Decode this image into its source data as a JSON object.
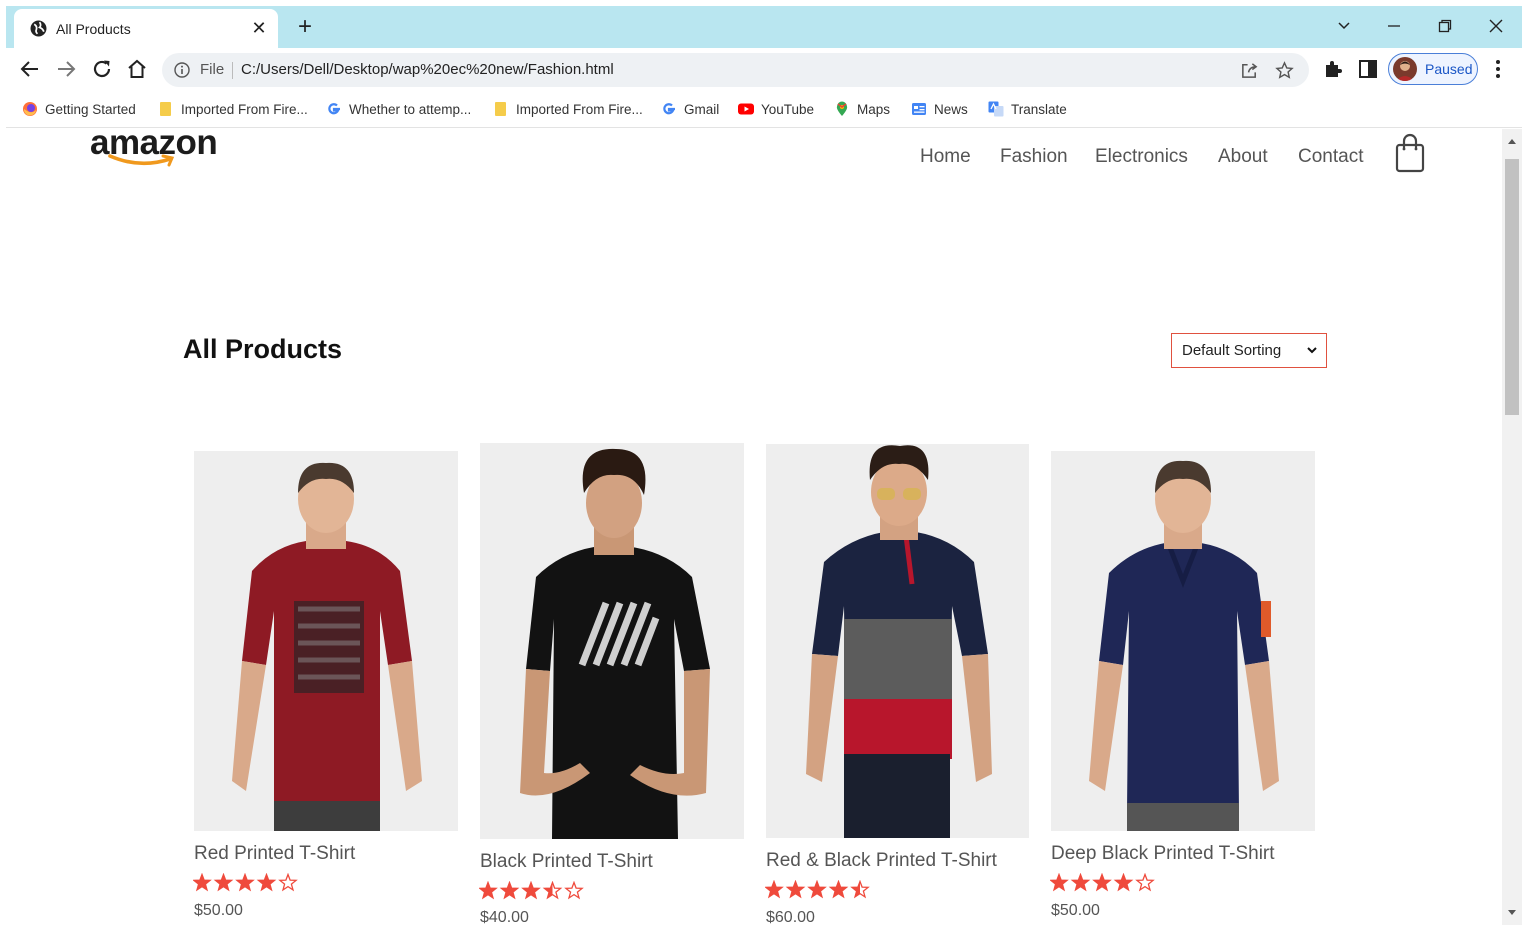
{
  "browser": {
    "tab_title": "All Products",
    "omnibox": {
      "scheme_label": "File",
      "url": "C:/Users/Dell/Desktop/wap%20ec%20new/Fashion.html"
    },
    "profile_label": "Paused",
    "bookmarks": [
      {
        "label": "Getting Started",
        "icon": "firefox-icon"
      },
      {
        "label": "Imported From Fire...",
        "icon": "folder-icon"
      },
      {
        "label": "Whether to attemp...",
        "icon": "google-icon"
      },
      {
        "label": "Imported From Fire...",
        "icon": "folder-icon"
      },
      {
        "label": "Gmail",
        "icon": "google-icon"
      },
      {
        "label": "YouTube",
        "icon": "youtube-icon"
      },
      {
        "label": "Maps",
        "icon": "maps-pin-icon"
      },
      {
        "label": "News",
        "icon": "news-icon"
      },
      {
        "label": "Translate",
        "icon": "translate-icon"
      }
    ]
  },
  "site": {
    "logo": "amazon",
    "nav": [
      "Home",
      "Fashion",
      "Electronics",
      "About",
      "Contact"
    ],
    "heading": "All Products",
    "sort": {
      "selected": "Default Sorting"
    }
  },
  "products": [
    {
      "name": "Red Printed T-Shirt",
      "rating": 4,
      "price": "$50.00",
      "shirt_color": "#8e1a24",
      "print": "graphic"
    },
    {
      "name": "Black Printed T-Shirt",
      "rating": 3.5,
      "price": "$40.00",
      "shirt_color": "#121212",
      "print": "stripes"
    },
    {
      "name": "Red & Black Printed T-Shirt",
      "rating": 4.5,
      "price": "$60.00",
      "shirt_color": "#1b2340",
      "print": "colorblock"
    },
    {
      "name": "Deep Black Printed T-Shirt",
      "rating": 4,
      "price": "$50.00",
      "shirt_color": "#1f2756",
      "print": "polo"
    }
  ],
  "colors": {
    "accent": "#ef4a3c",
    "sort_border": "#e0513f",
    "tabbar": "#b9e6f0"
  }
}
